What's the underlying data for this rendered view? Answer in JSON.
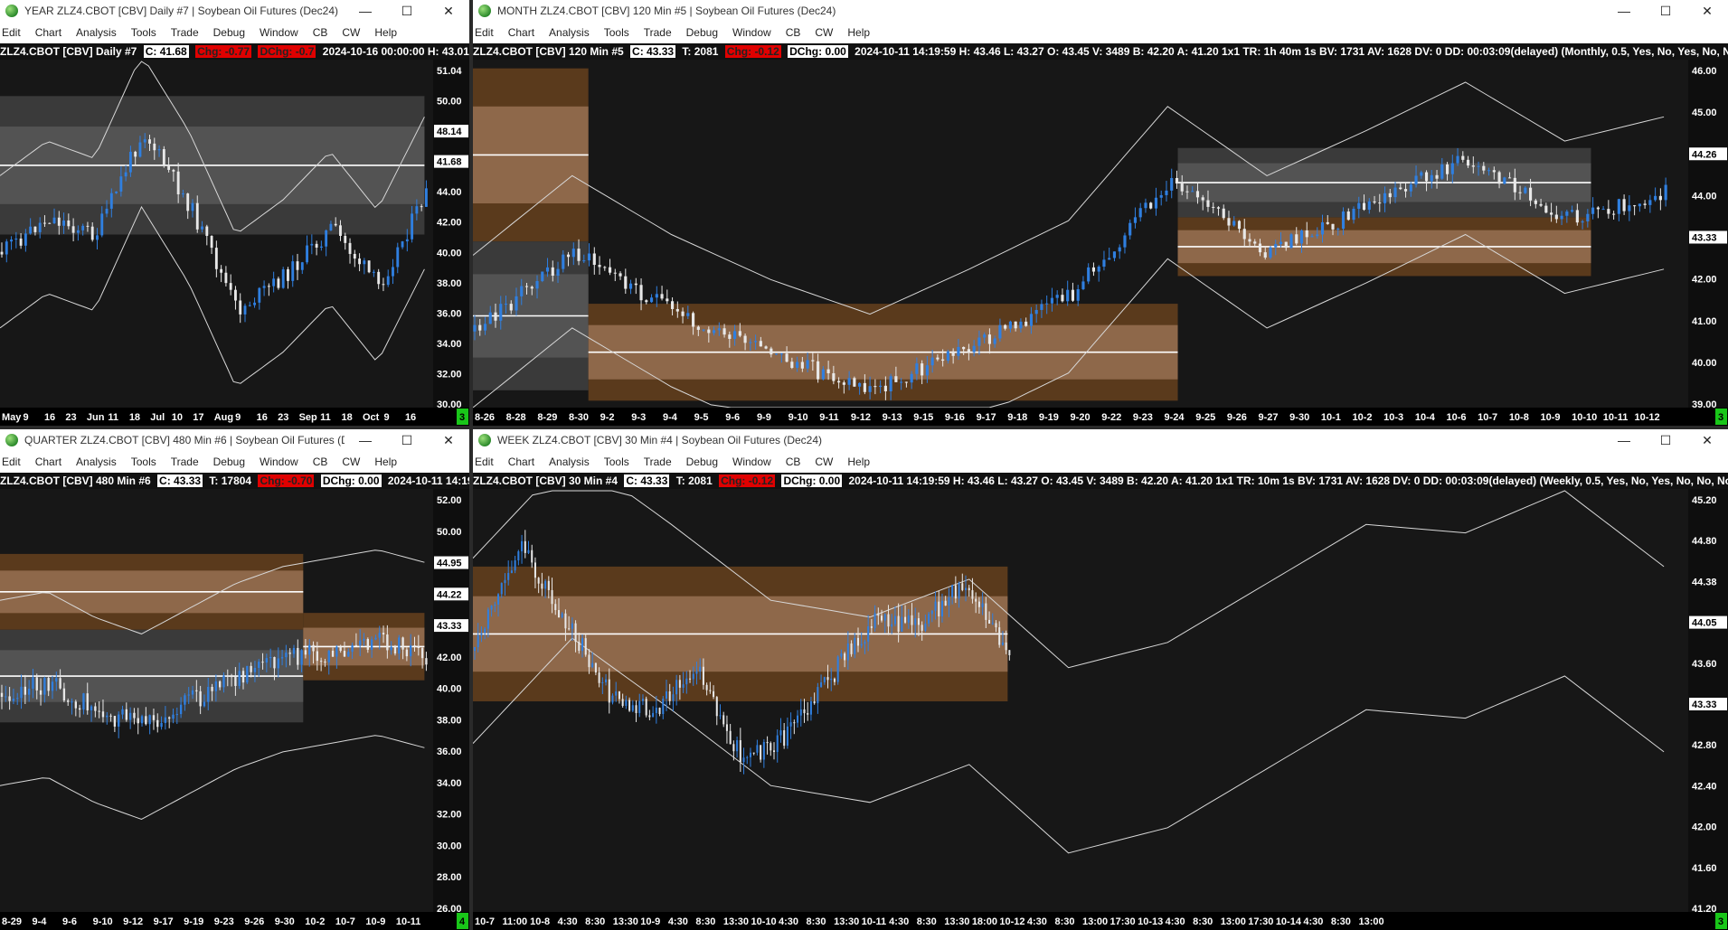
{
  "windows": {
    "year": {
      "title": "YEAR ZLZ4.CBOT [CBV]  Daily #7 | Soybean Oil Futures (Dec24)",
      "info": {
        "sym": "ZLZ4.CBOT [CBV]  Daily #7",
        "c": "C: 41.68",
        "chg": "Chg: -0.77",
        "dchg": "DChg: -0.7",
        "rest": "2024-10-16 00:00:00 H: 43.01 L: 41"
      },
      "yticks": [
        "51.04",
        "50.00",
        "48.14",
        "46.00",
        "44.00",
        "42.00",
        "40.00",
        "38.00",
        "36.00",
        "34.00",
        "32.00",
        "30.00"
      ],
      "price_tags": [
        "48.14",
        "41.68"
      ],
      "xticks": [
        "May",
        "9",
        "16",
        "23",
        "Jun",
        "11",
        "18",
        "Jul",
        "10",
        "17",
        "Aug",
        "9",
        "16",
        "23",
        "Sep",
        "11",
        "18",
        "Oct",
        "9",
        "16"
      ],
      "corner": "3"
    },
    "month": {
      "title": "MONTH ZLZ4.CBOT [CBV]  120 Min  #5 | Soybean Oil Futures (Dec24)",
      "info": {
        "sym": "ZLZ4.CBOT [CBV]  120 Min  #5",
        "c": "C: 43.33",
        "t": "T: 2081",
        "chg": "Chg: -0.12",
        "dchg": "DChg: 0.00",
        "rest": "2024-10-11 14:19:59 H: 43.46 L: 43.27 O: 43.45 V: 3489 B: 42.20 A: 41.20 1x1 TR: 1h 40m 1s BV: 1731 AV: 1628 DV: 0 DD: 00:03:09(delayed)  (Monthly, 0.5, Yes, No, Yes, No, No, No, #FF8000, No)  (Mon"
      },
      "yticks": [
        "46.00",
        "45.00",
        "44.26",
        "44.00",
        "43.33",
        "42.00",
        "41.00",
        "40.00",
        "39.00"
      ],
      "price_tags": [
        "44.26",
        "43.33"
      ],
      "xticks": [
        "8-26",
        "8-28",
        "8-29",
        "8-30",
        "9-2",
        "9-3",
        "9-4",
        "9-5",
        "9-6",
        "9-9",
        "9-10",
        "9-11",
        "9-12",
        "9-13",
        "9-15",
        "9-16",
        "9-17",
        "9-18",
        "9-19",
        "9-20",
        "9-22",
        "9-23",
        "9-24",
        "9-25",
        "9-26",
        "9-27",
        "9-30",
        "10-1",
        "10-2",
        "10-3",
        "10-4",
        "10-6",
        "10-7",
        "10-8",
        "10-9",
        "10-10",
        "10-11",
        "10-12"
      ],
      "corner": "3"
    },
    "quarter": {
      "title": "QUARTER ZLZ4.CBOT [CBV]  480 Min  #6 | Soybean Oil Futures (D...",
      "info": {
        "sym": "ZLZ4.CBOT [CBV]  480 Min  #6",
        "c": "C: 43.33",
        "t": "T: 17804",
        "chg": "Chg: -0.70",
        "dchg": "DChg: 0.00",
        "rest": "2024-10-11 14:19:59 H:"
      },
      "yticks": [
        "52.00",
        "50.00",
        "48.00",
        "46.00",
        "44.00",
        "42.00",
        "40.00",
        "38.00",
        "36.00",
        "34.00",
        "32.00",
        "30.00",
        "28.00",
        "26.00"
      ],
      "price_tags": [
        "44.95",
        "44.22",
        "43.33"
      ],
      "xticks": [
        "8-29",
        "9-4",
        "9-6",
        "9-10",
        "9-12",
        "9-17",
        "9-19",
        "9-23",
        "9-26",
        "9-30",
        "10-2",
        "10-7",
        "10-9",
        "10-11"
      ],
      "corner": "4"
    },
    "week": {
      "title": "WEEK ZLZ4.CBOT [CBV]  30 Min  #4 | Soybean Oil Futures (Dec24)",
      "info": {
        "sym": "ZLZ4.CBOT [CBV]  30 Min  #4",
        "c": "C: 43.33",
        "t": "T: 2081",
        "chg": "Chg: -0.12",
        "dchg": "DChg: 0.00",
        "rest": "2024-10-11 14:19:59 H: 43.46 L: 43.27 O: 43.45 V: 3489 B: 42.20 A: 41.20 1x1 TR: 10m 1s BV: 1731 AV: 1628 DV: 0 DD: 00:03:09(delayed)  (Weekly, 0.5, Yes, No, Yes, No, No, No, #FF8000, No)  (Weekly, 0"
      },
      "yticks": [
        "45.20",
        "44.80",
        "44.38",
        "44.05",
        "43.60",
        "43.33",
        "42.80",
        "42.40",
        "42.00",
        "41.60",
        "41.20"
      ],
      "price_tags": [
        "44.05",
        "43.33"
      ],
      "xticks": [
        "10-7",
        "11:00",
        "10-8",
        "4:30",
        "8:30",
        "13:30",
        "10-9",
        "4:30",
        "8:30",
        "13:30",
        "10-10",
        "4:30",
        "8:30",
        "13:30",
        "10-11",
        "4:30",
        "8:30",
        "13:30",
        "18:00",
        "10-12",
        "4:30",
        "8:30",
        "13:00",
        "17:30",
        "10-13",
        "4:30",
        "8:30",
        "13:00",
        "17:30",
        "10-14",
        "4:30",
        "8:30",
        "13:00"
      ],
      "corner": "3"
    }
  },
  "menu": [
    "Edit",
    "Chart",
    "Analysis",
    "Tools",
    "Trade",
    "Debug",
    "Window",
    "CB",
    "CW",
    "Help"
  ],
  "window_controls": {
    "minimize": "—",
    "maximize": "☐",
    "close": "✕"
  },
  "colors": {
    "background": "#171717",
    "candle_up": "#2f7fe0",
    "candle_down": "#e8e8e8",
    "brown_band": "#5a3a1c",
    "brown_light": "#a0785a",
    "gray_band": "#5c5c5c",
    "gray_light": "#8a8a8a",
    "chg_red": "#e00000",
    "corner_green": "#19c619"
  }
}
